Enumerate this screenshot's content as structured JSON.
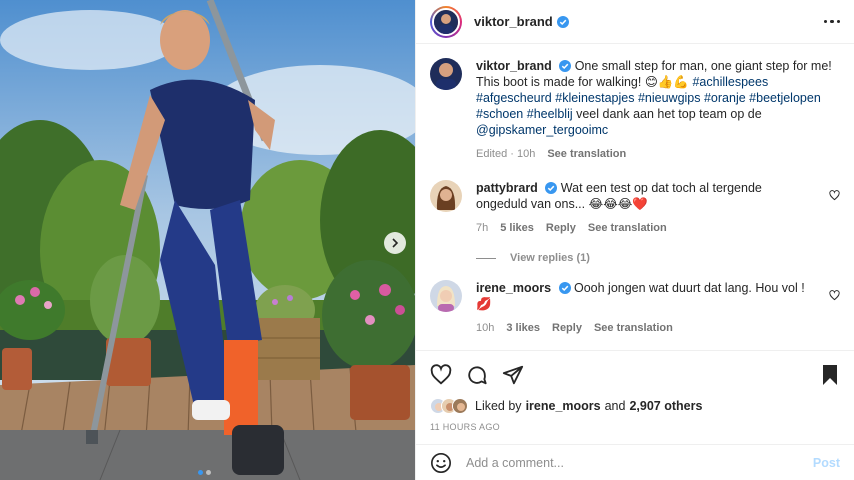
{
  "post": {
    "author": "viktor_brand",
    "more_label": "More options",
    "image_count": 2,
    "active_image": 1
  },
  "caption": {
    "username": "viktor_brand",
    "text": "One small step for man, one giant step for me! This boot is made for walking! 😊👍💪",
    "hashtags": [
      "#achillespees",
      "#afgescheurd",
      "#kleinestapjes",
      "#nieuwgips",
      "#oranje",
      "#beetjelopen",
      "#schoen",
      "#heelblij"
    ],
    "text_after": "veel dank aan het top team op de",
    "mention": "@gipskamer_tergooimc",
    "edited": "Edited · 10h",
    "see_translation": "See translation"
  },
  "comments": [
    {
      "username": "pattybrard",
      "text": "Wat een test op dat toch al tergende ongeduld van ons... 😂😂😂❤️",
      "time": "7h",
      "likes": "5 likes",
      "reply": "Reply",
      "see_translation": "See translation",
      "view_replies": "View replies (1)"
    },
    {
      "username": "irene_moors",
      "text": "Oooh jongen wat duurt dat lang. Hou vol ! 💋",
      "time": "10h",
      "likes": "3 likes",
      "reply": "Reply",
      "see_translation": "See translation"
    }
  ],
  "likes": {
    "prefix": "Liked by",
    "user": "irene_moors",
    "middle": "and",
    "others": "2,907 others"
  },
  "timestamp": "11 HOURS AGO",
  "add_comment": {
    "placeholder": "Add a comment...",
    "post_label": "Post"
  },
  "colors": {
    "verified": "#3897f0",
    "link": "#00376b",
    "muted": "#8e8e8e",
    "post_disabled": "#b3dbff"
  },
  "icons": {
    "like": "heart-icon",
    "comment": "comment-icon",
    "share": "paper-plane-icon",
    "save": "bookmark-icon",
    "emoji": "smiley-icon",
    "more": "ellipsis-icon",
    "next": "chevron-right-icon"
  }
}
